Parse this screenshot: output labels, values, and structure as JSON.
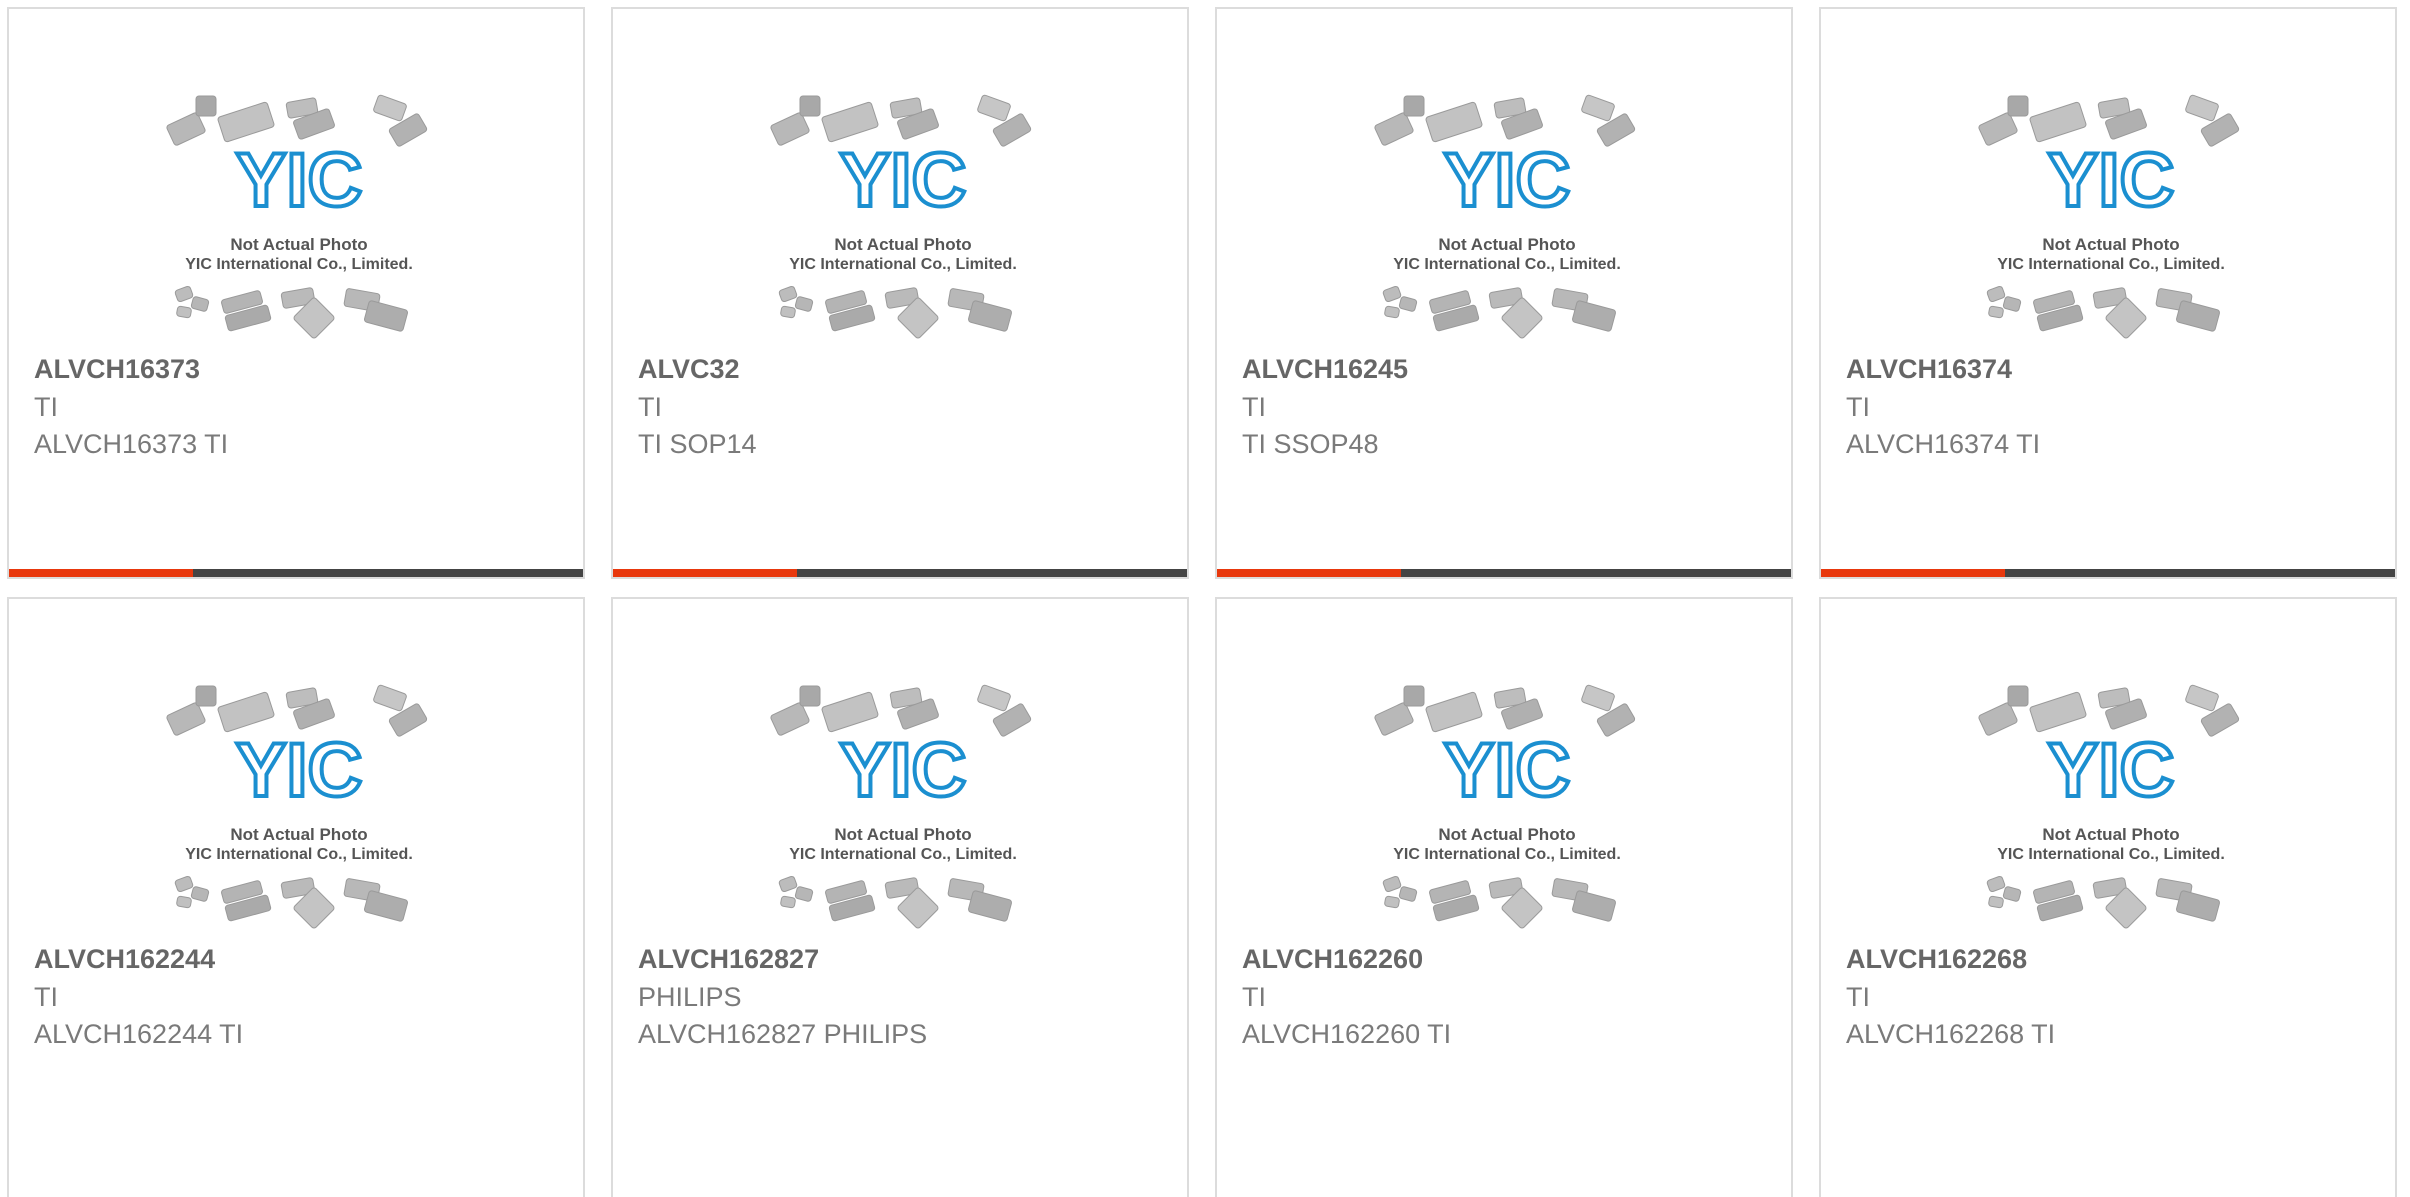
{
  "placeholder_image": {
    "caption_line1": "Not Actual Photo",
    "caption_line2": "YIC International Co., Limited.",
    "logo_text": "YIC",
    "logo_color": "#1b8fd0"
  },
  "accent_colors": {
    "progress_active": "#e8380d",
    "progress_track": "#444444"
  },
  "products": [
    {
      "part_number": "ALVCH16373",
      "manufacturer": "TI",
      "description": "ALVCH16373 TI",
      "progress": 0.32
    },
    {
      "part_number": "ALVC32",
      "manufacturer": "TI",
      "description": "TI SOP14",
      "progress": 0.32
    },
    {
      "part_number": "ALVCH16245",
      "manufacturer": "TI",
      "description": "TI SSOP48",
      "progress": 0.32
    },
    {
      "part_number": "ALVCH16374",
      "manufacturer": "TI",
      "description": "ALVCH16374 TI",
      "progress": 0.32
    },
    {
      "part_number": "ALVCH162244",
      "manufacturer": "TI",
      "description": "ALVCH162244 TI"
    },
    {
      "part_number": "ALVCH162827",
      "manufacturer": "PHILIPS",
      "description": "ALVCH162827 PHILIPS"
    },
    {
      "part_number": "ALVCH162260",
      "manufacturer": "TI",
      "description": "ALVCH162260 TI"
    },
    {
      "part_number": "ALVCH162268",
      "manufacturer": "TI",
      "description": "ALVCH162268 TI"
    }
  ]
}
